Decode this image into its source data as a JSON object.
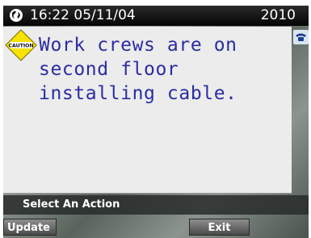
{
  "status_bar": {
    "datetime": "16:22 05/11/04",
    "extension": "2010",
    "left_icon": "globe-icon"
  },
  "message": {
    "icon": "caution-icon",
    "icon_label": "CAUTION",
    "text": "Work crews are on\nsecond floor\ninstalling cable."
  },
  "side_icon": "phone-icon",
  "action_bar": {
    "label": "Select An Action"
  },
  "softkeys": {
    "update": "Update",
    "exit": "Exit"
  },
  "colors": {
    "message_text": "#2b2ca4",
    "caution_yellow": "#f7e200",
    "panel_bg": "#ececec"
  }
}
